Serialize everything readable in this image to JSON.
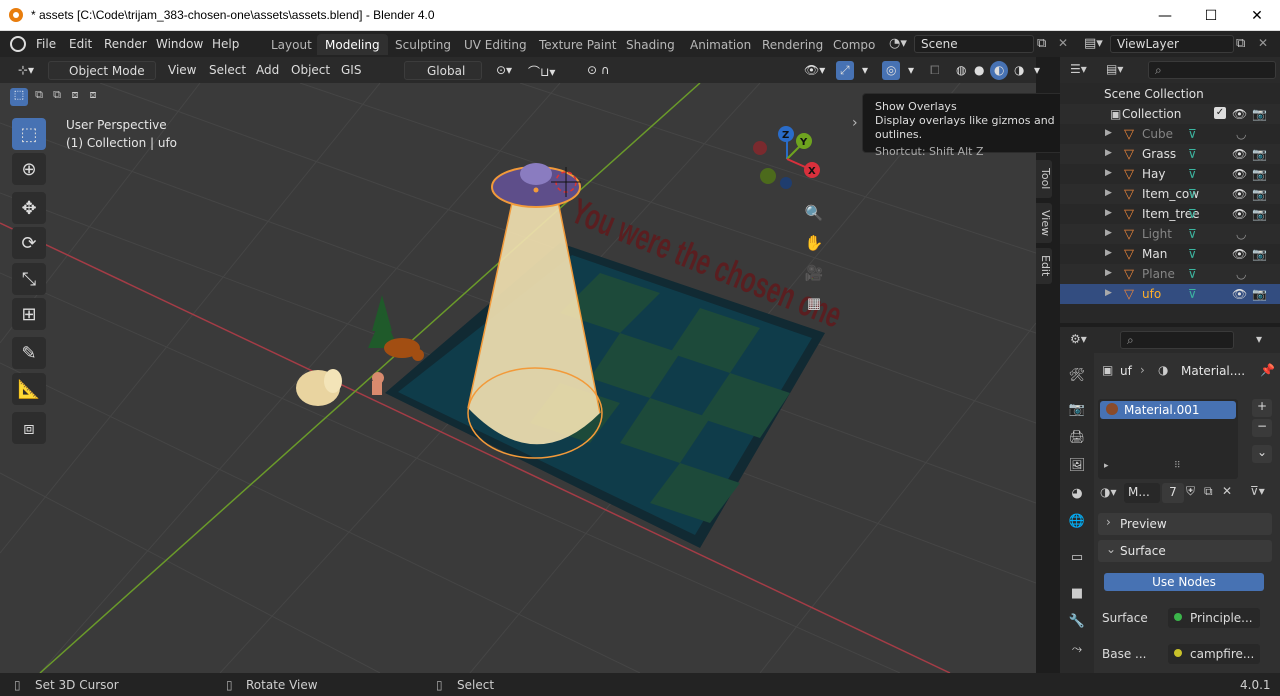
{
  "window": {
    "title": "* assets [C:\\Code\\trijam_383-chosen-one\\assets\\assets.blend] - Blender 4.0",
    "minimize_icon": "minimize-icon",
    "maximize_icon": "maximize-icon",
    "close_icon": "close-icon"
  },
  "menu": {
    "items": [
      "File",
      "Edit",
      "Render",
      "Window",
      "Help"
    ]
  },
  "workspaces": {
    "tabs": [
      "Layout",
      "Modeling",
      "Sculpting",
      "UV Editing",
      "Texture Paint",
      "Shading",
      "Animation",
      "Rendering",
      "Compo"
    ],
    "active": "Modeling"
  },
  "scene": {
    "name": "Scene"
  },
  "view_layer": {
    "name": "ViewLayer"
  },
  "viewport_header": {
    "mode": "Object Mode",
    "menus": [
      "View",
      "Select",
      "Add",
      "Object",
      "GIS"
    ],
    "transform_orientation": "Global"
  },
  "viewport": {
    "perspective_label": "User Perspective",
    "collection_label": "(1) Collection | ufo",
    "overlay_text": "You were the chosen one",
    "axis_labels": {
      "z": "Z",
      "y": "Y",
      "x": "X"
    },
    "side_tabs": [
      "Tool",
      "View",
      "Edit"
    ]
  },
  "tooltip": {
    "title": "Show Overlays",
    "description": "Display overlays like gizmos and outlines.",
    "shortcut": "Shortcut: Shift Alt Z"
  },
  "outliner": {
    "scene_collection": "Scene Collection",
    "collection": "Collection",
    "items": [
      {
        "name": "Cube",
        "dim": true
      },
      {
        "name": "Grass",
        "dim": false
      },
      {
        "name": "Hay",
        "dim": false
      },
      {
        "name": "Item_cow",
        "dim": false
      },
      {
        "name": "Item_tree",
        "dim": false
      },
      {
        "name": "Light",
        "dim": true
      },
      {
        "name": "Man",
        "dim": false
      },
      {
        "name": "Plane",
        "dim": true
      },
      {
        "name": "ufo",
        "dim": false,
        "selected": true
      }
    ]
  },
  "properties": {
    "breadcrumb_object": "uf",
    "breadcrumb_material": "Material....",
    "material_slot": "Material.001",
    "material_short": "M...",
    "user_count": "7",
    "panels": {
      "preview": "Preview",
      "surface": "Surface",
      "use_nodes": "Use Nodes",
      "surface_label": "Surface",
      "surface_value": "Principle...",
      "base_label": "Base ...",
      "base_value": "campfire..."
    }
  },
  "statusbar": {
    "left": "Set 3D Cursor",
    "middle": "Rotate View",
    "right": "Select",
    "version": "4.0.1"
  },
  "colors": {
    "accent": "#4772b3",
    "selected_orange": "#ffaf29",
    "viewport_bg": "#3a3a3a"
  }
}
